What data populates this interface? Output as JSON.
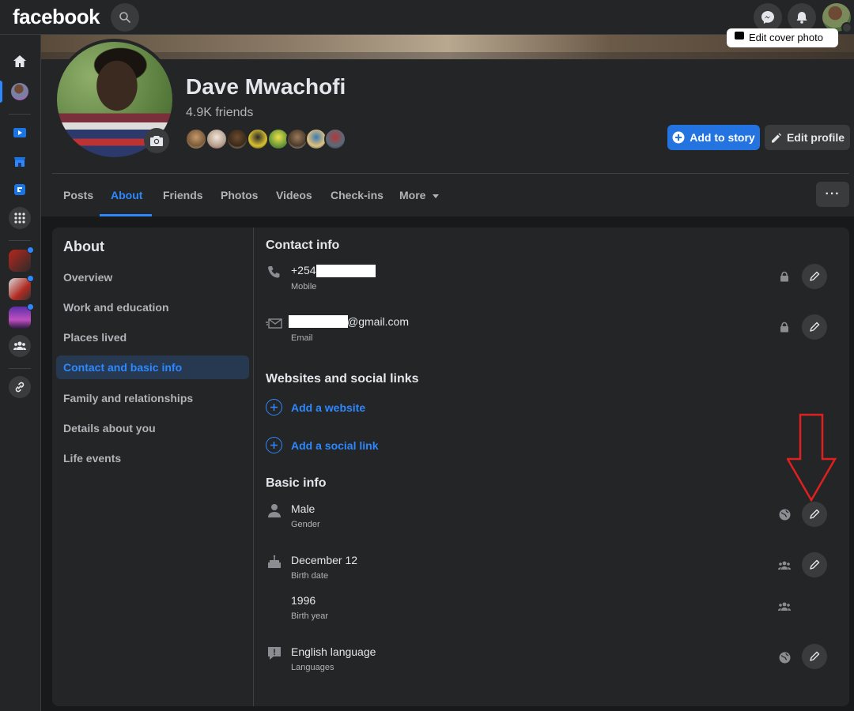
{
  "topbar": {
    "logo": "facebook"
  },
  "cover": {
    "edit_label": "Edit cover photo"
  },
  "profile": {
    "name": "Dave Mwachofi",
    "friends": "4.9K friends",
    "add_story_label": "Add to story",
    "edit_profile_label": "Edit profile"
  },
  "tabs": [
    {
      "label": "Posts"
    },
    {
      "label": "About"
    },
    {
      "label": "Friends"
    },
    {
      "label": "Photos"
    },
    {
      "label": "Videos"
    },
    {
      "label": "Check-ins"
    },
    {
      "label": "More"
    }
  ],
  "more_dots": "···",
  "about": {
    "title": "About",
    "nav": [
      {
        "label": "Overview"
      },
      {
        "label": "Work and education"
      },
      {
        "label": "Places lived"
      },
      {
        "label": "Contact and basic info"
      },
      {
        "label": "Family and relationships"
      },
      {
        "label": "Details about you"
      },
      {
        "label": "Life events"
      }
    ]
  },
  "contact": {
    "title": "Contact info",
    "phone": {
      "value": "+254",
      "label": "Mobile"
    },
    "email": {
      "value": "@gmail.com",
      "label": "Email"
    }
  },
  "websites": {
    "title": "Websites and social links",
    "add_website": "Add a website",
    "add_social": "Add a social link"
  },
  "basic": {
    "title": "Basic info",
    "gender": {
      "value": "Male",
      "label": "Gender"
    },
    "birth_date": {
      "value": "December 12",
      "label": "Birth date"
    },
    "birth_year": {
      "value": "1996",
      "label": "Birth year"
    },
    "languages": {
      "value": "English language",
      "label": "Languages"
    }
  },
  "colors": {
    "background": "#18191a",
    "surface": "#242526",
    "accent": "#2d88ff",
    "annotation": "#e02020"
  }
}
